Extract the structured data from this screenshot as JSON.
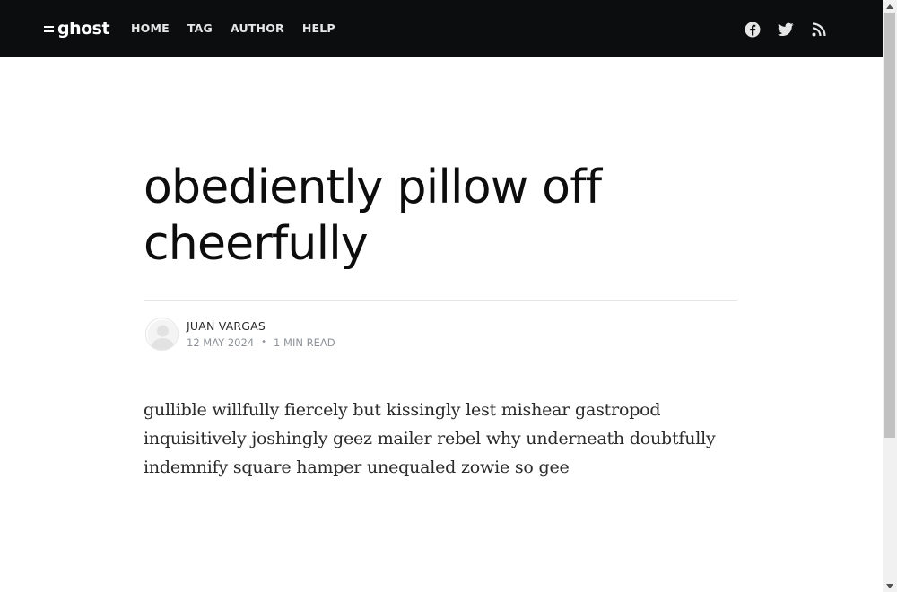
{
  "header": {
    "logo_text": "ghost",
    "nav": [
      {
        "label": "HOME"
      },
      {
        "label": "TAG"
      },
      {
        "label": "AUTHOR"
      },
      {
        "label": "HELP"
      }
    ],
    "social_icons": [
      "facebook-icon",
      "twitter-icon",
      "rss-icon"
    ]
  },
  "post": {
    "title": "obediently pillow off cheerfully",
    "author": "JUAN VARGAS",
    "date": "12 MAY 2024",
    "separator": "•",
    "reading_time": "1 MIN READ",
    "body": "gullible willfully fiercely but kissingly lest mishear gastropod inquisitively joshingly geez mailer rebel why underneath doubtfully indemnify square hamper unequaled zowie so gee"
  },
  "colors": {
    "header_bg": "#0c0d0e",
    "text": "#15171a",
    "meta": "#8e9399"
  }
}
